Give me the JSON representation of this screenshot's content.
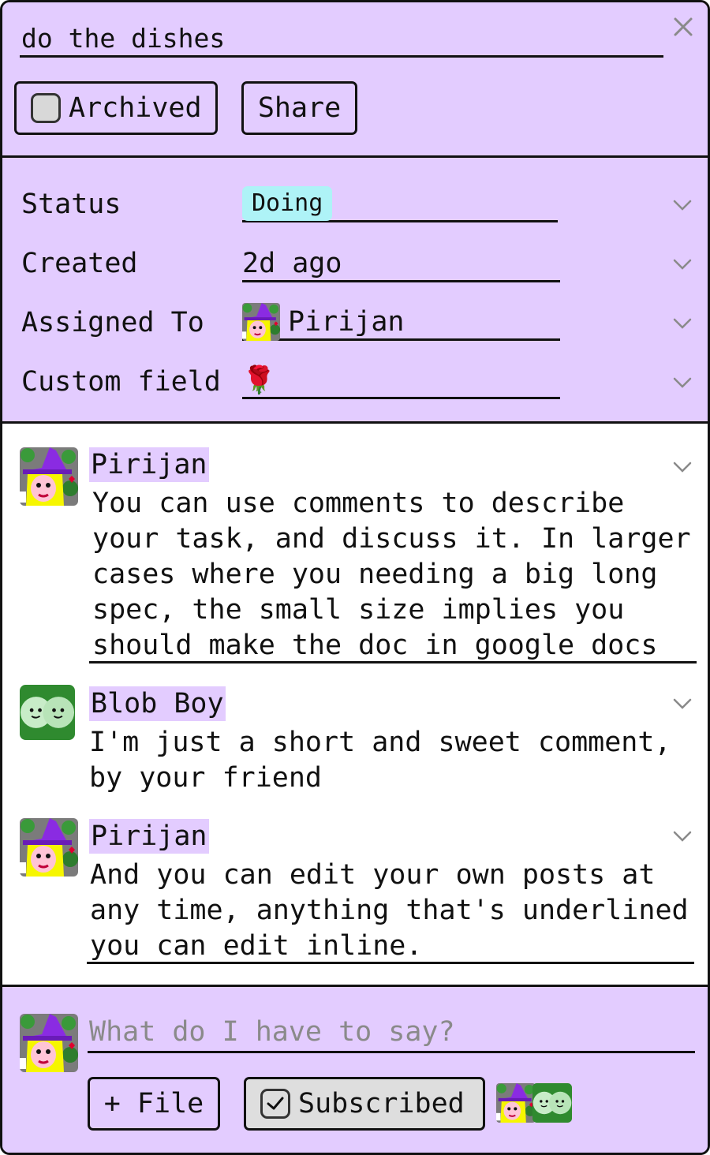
{
  "task": {
    "title": "do the dishes",
    "archived_label": "Archived",
    "share_label": "Share"
  },
  "fields": [
    {
      "label": "Status",
      "value": "Doing"
    },
    {
      "label": "Created",
      "value": "2d ago"
    },
    {
      "label": "Assigned To",
      "value": "Pirijan"
    },
    {
      "label": "Custom field",
      "value": "🌹"
    }
  ],
  "comments": [
    {
      "author": "Pirijan",
      "text": "You can use comments to describe\nyour task, and discuss it. In larger\ncases where you needing a big long\nspec, the small size implies you\nshould make the doc in google docs"
    },
    {
      "author": "Blob Boy",
      "text": "I'm just a short and sweet comment,\nby your friend"
    },
    {
      "author": "Pirijan",
      "text": "And you can edit your own posts at\nany time, anything that's underlined\nyou can edit inline."
    }
  ],
  "compose": {
    "placeholder": "What do I have to say?",
    "file_label": "+ File",
    "subscribed_label": "Subscribed"
  },
  "colors": {
    "panel": "#e3ccff",
    "status_badge": "#aef3f7",
    "border": "#111111"
  },
  "icons": {
    "close": "close-icon",
    "expand": "chevron-down-icon",
    "checkbox": "checkbox-icon",
    "checkmark": "checkmark-icon"
  }
}
